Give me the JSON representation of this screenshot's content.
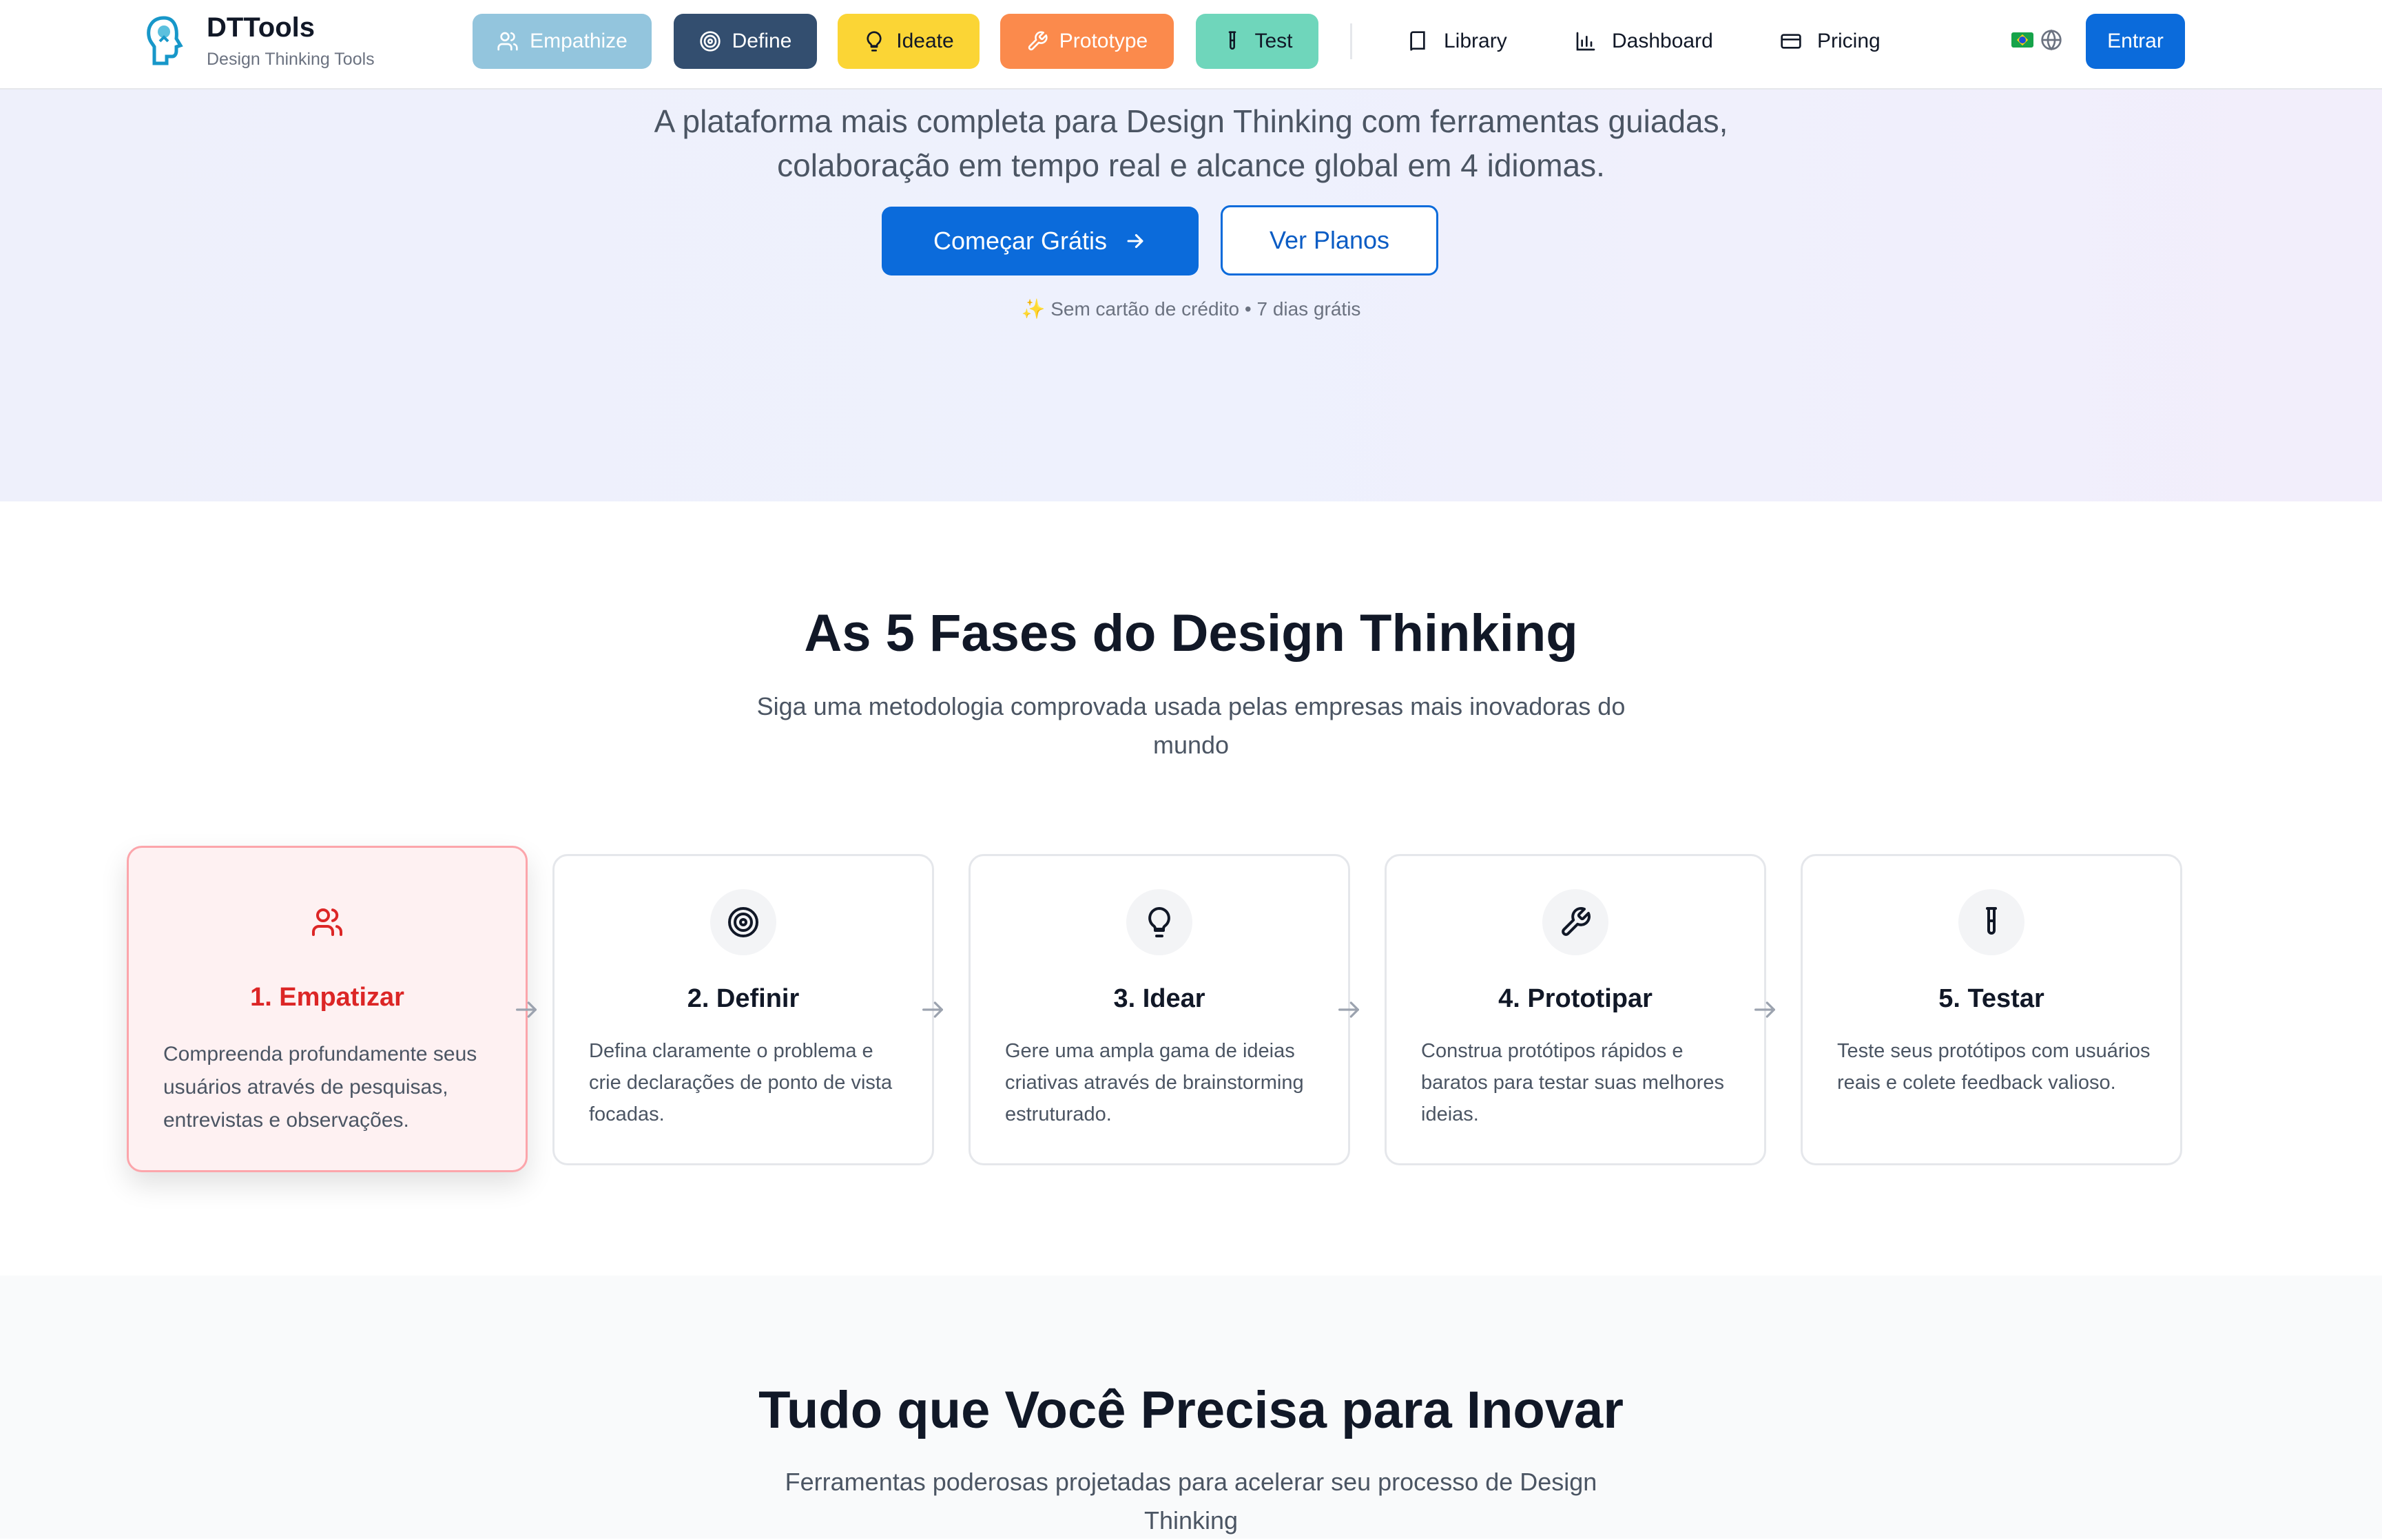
{
  "brand": {
    "name": "DTTools",
    "tagline": "Design Thinking Tools"
  },
  "header": {
    "phases": [
      {
        "label": "Empathize",
        "icon": "users-icon",
        "bg": "#93c5dd",
        "fg": "#ffffff"
      },
      {
        "label": "Define",
        "icon": "target-icon",
        "bg": "#334e6f",
        "fg": "#ffffff"
      },
      {
        "label": "Ideate",
        "icon": "lightbulb-icon",
        "bg": "#fbd535",
        "fg": "#111827"
      },
      {
        "label": "Prototype",
        "icon": "wrench-icon",
        "bg": "#fb8a4c",
        "fg": "#ffffff"
      },
      {
        "label": "Test",
        "icon": "test-tube-icon",
        "bg": "#6fd6bb",
        "fg": "#111827"
      }
    ],
    "nav": [
      {
        "label": "Library",
        "icon": "book-icon"
      },
      {
        "label": "Dashboard",
        "icon": "bar-chart-icon"
      },
      {
        "label": "Pricing",
        "icon": "credit-card-icon"
      }
    ],
    "login_label": "Entrar",
    "language_icon": "globe-icon",
    "flag": "brazil-flag-icon"
  },
  "hero": {
    "line1": "A plataforma mais completa para Design Thinking com ferramentas guiadas,",
    "line2": "colaboração em tempo real e alcance global em 4 idiomas.",
    "cta_primary": "Começar Grátis",
    "cta_secondary": "Ver Planos",
    "note": "✨ Sem cartão de crédito • 7 dias grátis"
  },
  "phases_section": {
    "title": "As 5 Fases do Design Thinking",
    "subtitle_line1": "Siga uma metodologia comprovada usada pelas empresas mais inovadoras do",
    "subtitle_line2": "mundo",
    "cards": [
      {
        "title": "1. Empatizar",
        "icon": "users-icon",
        "desc": "Compreenda profundamente seus usuários através de pesquisas, entrevistas e observações."
      },
      {
        "title": "2. Definir",
        "icon": "target-icon",
        "desc": "Defina claramente o problema e crie declarações de ponto de vista focadas."
      },
      {
        "title": "3. Idear",
        "icon": "lightbulb-icon",
        "desc": "Gere uma ampla gama de ideias criativas através de brainstorming estruturado."
      },
      {
        "title": "4. Prototipar",
        "icon": "wrench-icon",
        "desc": "Construa protótipos rápidos e baratos para testar suas melhores ideias."
      },
      {
        "title": "5. Testar",
        "icon": "test-tube-icon",
        "desc": "Teste seus protótipos com usuários reais e colete feedback valioso."
      }
    ],
    "accent_active": "#dc2626"
  },
  "tools_section": {
    "title": "Tudo que Você Precisa para Inovar",
    "subtitle_line1": "Ferramentas poderosas projetadas para acelerar seu processo de Design",
    "subtitle_line2": "Thinking"
  },
  "colors": {
    "primary": "#0b6bdb"
  }
}
